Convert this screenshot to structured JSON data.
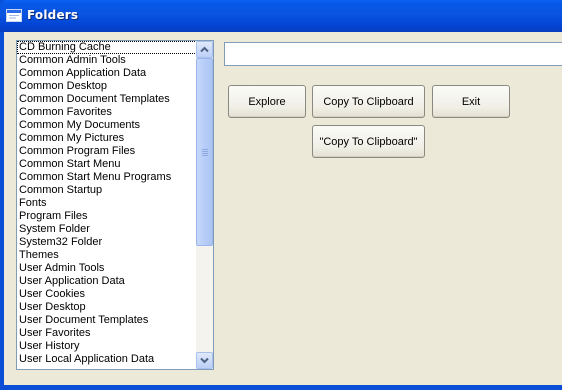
{
  "window": {
    "title": "Folders",
    "accent": "#0a4fd6"
  },
  "folders_list": {
    "items": [
      "CD Burning Cache",
      "Common Admin Tools",
      "Common Application Data",
      "Common Desktop",
      "Common Document Templates",
      "Common Favorites",
      "Common My Documents",
      "Common My Pictures",
      "Common Program Files",
      "Common Start Menu",
      "Common Start Menu Programs",
      "Common Startup",
      "Fonts",
      "Program Files",
      "System Folder",
      "System32 Folder",
      "Themes",
      "User Admin Tools",
      "User Application Data",
      "User Cookies",
      "User Desktop",
      "User Document Templates",
      "User Favorites",
      "User History",
      "User Local Application Data"
    ],
    "selected_index": 0
  },
  "path_field": {
    "value": ""
  },
  "buttons": {
    "explore": "Explore",
    "copy": "Copy To Clipboard",
    "exit": "Exit",
    "copy_quoted": "\"Copy To Clipboard\""
  },
  "icons": {
    "window": "window-icon",
    "scroll_up": "chevron-up-icon",
    "scroll_down": "chevron-down-icon"
  }
}
